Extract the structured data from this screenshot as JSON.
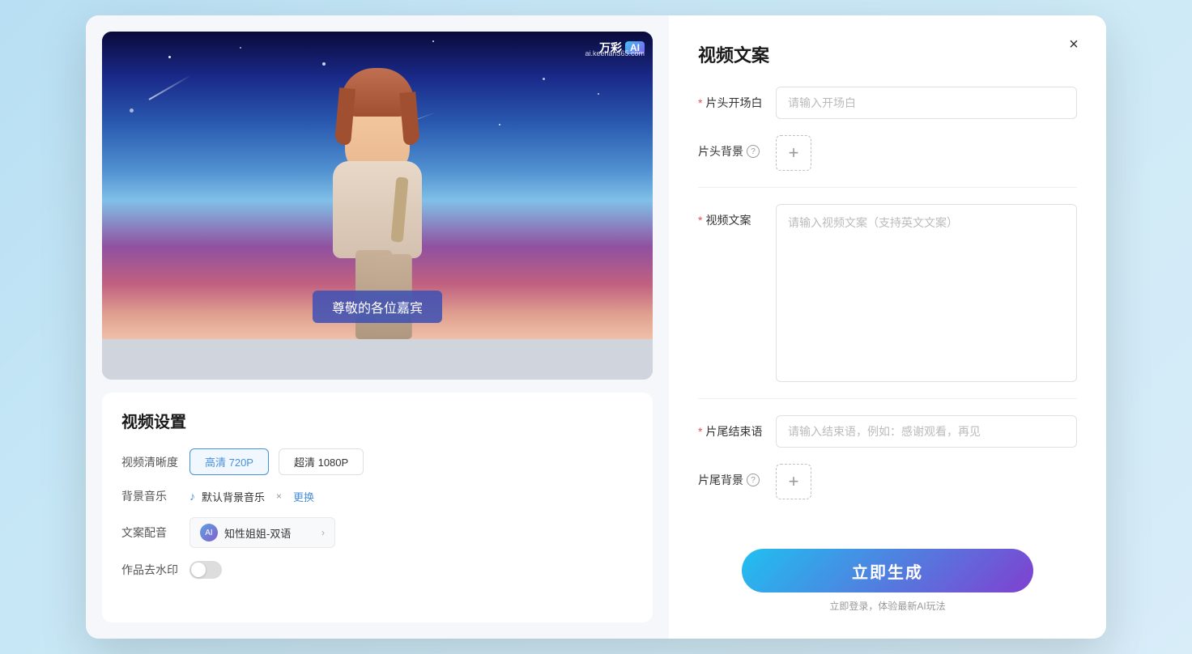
{
  "modal": {
    "close_label": "×"
  },
  "left": {
    "watermark_brand": "万彩",
    "watermark_ai": "AI",
    "watermark_url": "ai.keehan365.com",
    "subtitle_text": "尊敬的各位嘉宾",
    "settings_title": "视频设置",
    "quality_label": "视频清晰度",
    "quality_options": [
      {
        "label": "高清 720P",
        "active": true
      },
      {
        "label": "超清 1080P",
        "active": false
      }
    ],
    "music_label": "背景音乐",
    "music_note_icon": "♪",
    "music_name": "默认背景音乐",
    "music_remove": "×",
    "music_change": "更换",
    "voice_label": "文案配音",
    "voice_name": "知性姐姐-双语",
    "voice_chevron": "›",
    "watermark_label": "作品去水印"
  },
  "right": {
    "panel_title": "视频文案",
    "opening_label": "片头开场白",
    "opening_required": "*",
    "opening_placeholder": "请输入开场白",
    "bg_header_label": "片头背景",
    "bg_header_add": "+",
    "video_copy_label": "视频文案",
    "video_copy_required": "*",
    "video_copy_placeholder": "请输入视频文案（支持英文文案）",
    "ending_label": "片尾结束语",
    "ending_required": "*",
    "ending_placeholder": "请输入结束语，例如：感谢观看，再见",
    "bg_footer_label": "片尾背景",
    "bg_footer_add": "+",
    "generate_btn_label": "立即生成",
    "generate_hint": "立即登录，体验最新AI玩法"
  }
}
